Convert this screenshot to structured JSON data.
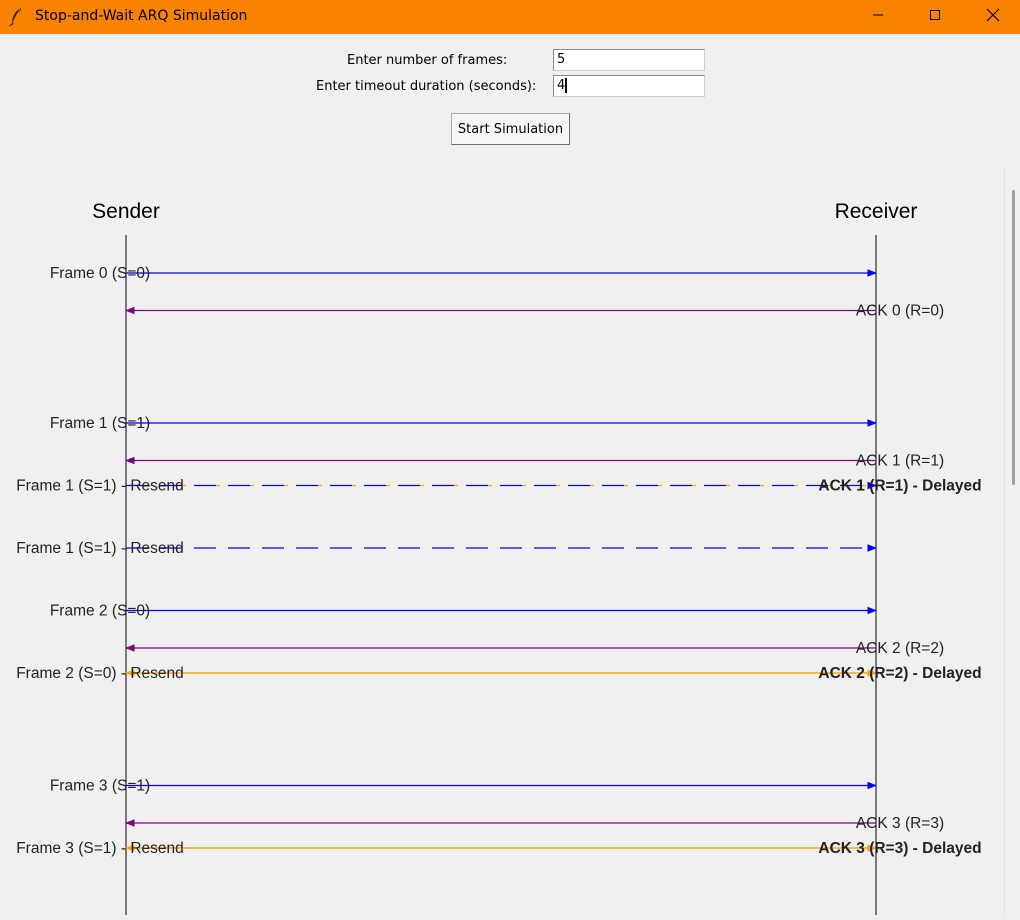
{
  "window": {
    "title": "Stop-and-Wait ARQ Simulation",
    "icon": "feather-icon",
    "controls": [
      "minimize-icon",
      "maximize-icon",
      "close-icon"
    ],
    "title_bar_color": "#f98200"
  },
  "form": {
    "frames_label": "Enter number of frames:",
    "frames_value": "5",
    "timeout_label": "Enter timeout duration (seconds):",
    "timeout_value": "4",
    "start_button": "Start Simulation"
  },
  "diagram": {
    "sender_label": "Sender",
    "receiver_label": "Receiver",
    "colors": {
      "frame": "#0000ee",
      "ack": "#800080",
      "delayed": "#ffa500",
      "resend": "#0000ee",
      "timeline": "#000000"
    },
    "events": [
      {
        "kind": "frame",
        "left_label": "Frame 0 (S=0)",
        "right_label": ""
      },
      {
        "kind": "ack",
        "left_label": "",
        "right_label": "ACK 0 (R=0)"
      },
      {
        "kind": "gap"
      },
      {
        "kind": "gap"
      },
      {
        "kind": "frame",
        "left_label": "Frame 1 (S=1)",
        "right_label": ""
      },
      {
        "kind": "ack",
        "left_label": "",
        "right_label": "ACK 1 (R=1)"
      },
      {
        "kind": "resend_delayed_dashed",
        "left_label": "Frame 1 (S=1) - Resend",
        "right_label": "ACK 1 (R=1) - Delayed"
      },
      {
        "kind": "resend",
        "left_label": "Frame 1 (S=1) - Resend",
        "right_label": ""
      },
      {
        "kind": "frame",
        "left_label": "Frame 2 (S=0)",
        "right_label": ""
      },
      {
        "kind": "ack",
        "left_label": "",
        "right_label": "ACK 2 (R=2)"
      },
      {
        "kind": "resend_delayed",
        "left_label": "Frame 2 (S=0) - Resend",
        "right_label": "ACK 2 (R=2) - Delayed"
      },
      {
        "kind": "gap"
      },
      {
        "kind": "gap"
      },
      {
        "kind": "frame",
        "left_label": "Frame 3 (S=1)",
        "right_label": ""
      },
      {
        "kind": "ack",
        "left_label": "",
        "right_label": "ACK 3 (R=3)"
      },
      {
        "kind": "resend_delayed",
        "left_label": "Frame 3 (S=1) - Resend",
        "right_label": "ACK 3 (R=3) - Delayed"
      }
    ]
  }
}
